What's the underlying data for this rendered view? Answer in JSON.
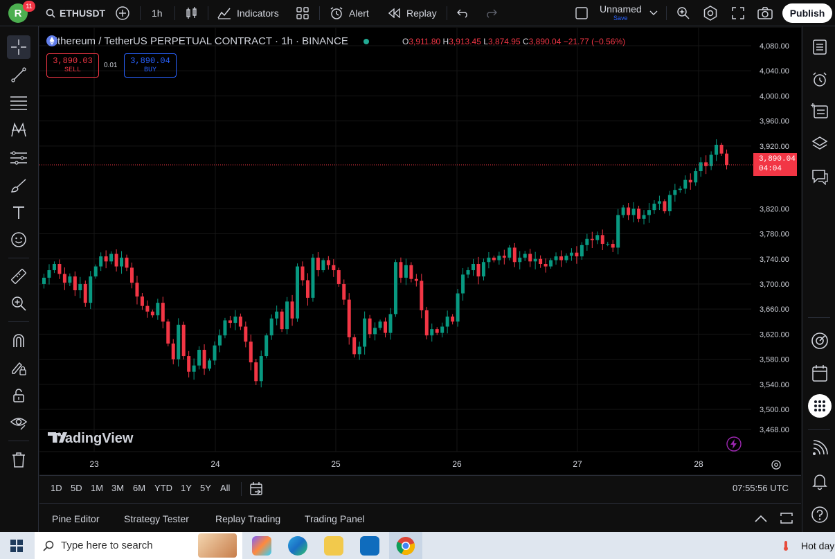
{
  "colors": {
    "up": "#089981",
    "down": "#f23645",
    "accent": "#2962ff",
    "bg": "#000000",
    "panel": "#0f0f0f"
  },
  "topbar": {
    "avatar_letter": "R",
    "notification_count": "11",
    "symbol": "ETHUSDT",
    "interval": "1h",
    "indicators_label": "Indicators",
    "alert_label": "Alert",
    "replay_label": "Replay",
    "layout_name": "Unnamed",
    "layout_save": "Save",
    "publish_label": "Publish"
  },
  "legend": {
    "title": "Ethereum / TetherUS PERPETUAL CONTRACT · 1h · BINANCE",
    "o_label": "O",
    "o": "3,911.80",
    "h_label": "H",
    "h": "3,913.45",
    "l_label": "L",
    "l": "3,874.95",
    "c_label": "C",
    "c": "3,890.04",
    "change": "−21.77 (−0.56%)"
  },
  "trade": {
    "sell_price": "3,890.03",
    "sell_label": "SELL",
    "spread": "0.01",
    "buy_price": "3,890.04",
    "buy_label": "BUY"
  },
  "price_axis": {
    "ticks": [
      "4,080.00",
      "4,040.00",
      "4,000.00",
      "3,960.00",
      "3,920.00",
      "3,820.00",
      "3,780.00",
      "3,740.00",
      "3,700.00",
      "3,660.00",
      "3,620.00",
      "3,580.00",
      "3,540.00",
      "3,500.00",
      "3,468.00"
    ],
    "tick_values": [
      4080,
      4040,
      4000,
      3960,
      3920,
      3820,
      3780,
      3740,
      3700,
      3660,
      3620,
      3580,
      3540,
      3500,
      3468
    ],
    "last_price": "3,890.04",
    "countdown": "04:04"
  },
  "time_axis": {
    "labels": [
      "23",
      "24",
      "25",
      "26",
      "27",
      "28"
    ]
  },
  "watermark": "TradingView",
  "range_bar": {
    "ranges": [
      "1D",
      "5D",
      "1M",
      "3M",
      "6M",
      "YTD",
      "1Y",
      "5Y",
      "All"
    ],
    "utc_time": "07:55:56 UTC"
  },
  "bottom_panel": {
    "tabs": [
      "Pine Editor",
      "Strategy Tester",
      "Replay Trading",
      "Trading Panel"
    ]
  },
  "taskbar": {
    "search_placeholder": "Type here to search",
    "weather": "Hot day"
  },
  "chart_data": {
    "type": "candlestick",
    "title": "Ethereum / TetherUS PERPETUAL CONTRACT · 1h · BINANCE",
    "ylim": [
      3450,
      4100
    ],
    "x_labels": [
      "23",
      "24",
      "25",
      "26",
      "27",
      "28"
    ],
    "closes": [
      3700,
      3710,
      3722,
      3732,
      3716,
      3702,
      3712,
      3690,
      3700,
      3670,
      3712,
      3728,
      3744,
      3736,
      3748,
      3728,
      3742,
      3726,
      3702,
      3680,
      3665,
      3656,
      3650,
      3670,
      3640,
      3605,
      3580,
      3635,
      3585,
      3560,
      3570,
      3595,
      3565,
      3578,
      3602,
      3618,
      3642,
      3638,
      3648,
      3632,
      3608,
      3575,
      3545,
      3585,
      3618,
      3645,
      3656,
      3628,
      3672,
      3645,
      3728,
      3706,
      3678,
      3742,
      3722,
      3738,
      3730,
      3722,
      3700,
      3675,
      3615,
      3588,
      3600,
      3645,
      3620,
      3630,
      3640,
      3622,
      3652,
      3735,
      3710,
      3730,
      3708,
      3705,
      3658,
      3618,
      3628,
      3622,
      3632,
      3648,
      3640,
      3685,
      3715,
      3722,
      3732,
      3712,
      3735,
      3742,
      3738,
      3745,
      3742,
      3758,
      3735,
      3742,
      3748,
      3736,
      3740,
      3732,
      3728,
      3738,
      3744,
      3738,
      3745,
      3750,
      3744,
      3762,
      3772,
      3770,
      3778,
      3764,
      3764,
      3758,
      3810,
      3822,
      3810,
      3820,
      3804,
      3810,
      3818,
      3828,
      3832,
      3816,
      3842,
      3850,
      3852,
      3866,
      3862,
      3880,
      3894,
      3888,
      3906,
      3922,
      3908,
      3890
    ]
  }
}
